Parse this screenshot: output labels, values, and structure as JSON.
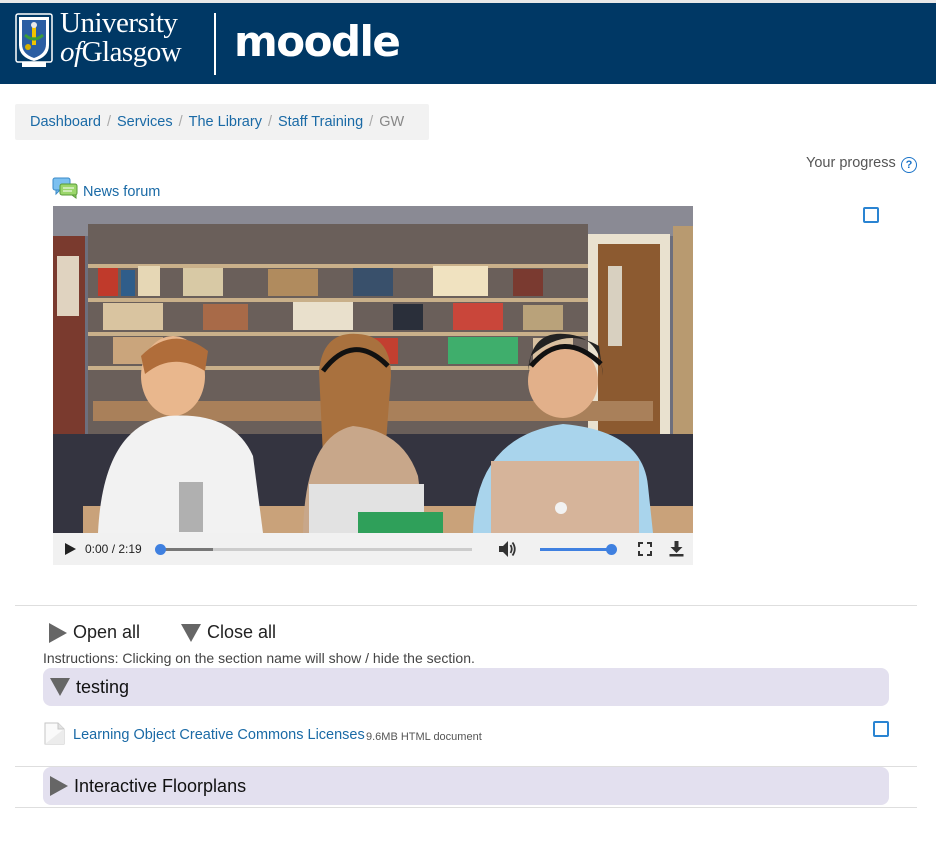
{
  "header": {
    "university_line1": "University",
    "university_line2_of": "of",
    "university_line2_name": "Glasgow",
    "moodle_label": "moodle",
    "crest_icon": "university-crest-icon"
  },
  "breadcrumb": {
    "items": [
      "Dashboard",
      "Services",
      "The Library",
      "Staff Training"
    ],
    "current": "GW",
    "separator": "/"
  },
  "progress": {
    "label": "Your progress",
    "help_icon": "help-icon"
  },
  "news_forum": {
    "label": "News forum",
    "icon": "forum-icon"
  },
  "video": {
    "time": "0:00 / 2:19",
    "progress_fraction": 0,
    "buffered_fraction": 0.17,
    "volume_fraction": 1.0
  },
  "sections_controls": {
    "open_all": "Open all",
    "close_all": "Close all",
    "instructions": "Instructions: Clicking on the section name will show / hide the section."
  },
  "sections": [
    {
      "title": "testing",
      "expanded": true
    },
    {
      "title": "Interactive Floorplans",
      "expanded": false
    }
  ],
  "resource": {
    "label": "Learning Object Creative Commons Licenses",
    "meta": "9.6MB HTML document",
    "icon": "file-icon"
  },
  "colors": {
    "header_bg": "#003865",
    "link": "#1a6aa6",
    "section_bg": "#e3e0ef",
    "checkbox": "#2a84d2",
    "slider": "#3f80e0"
  }
}
